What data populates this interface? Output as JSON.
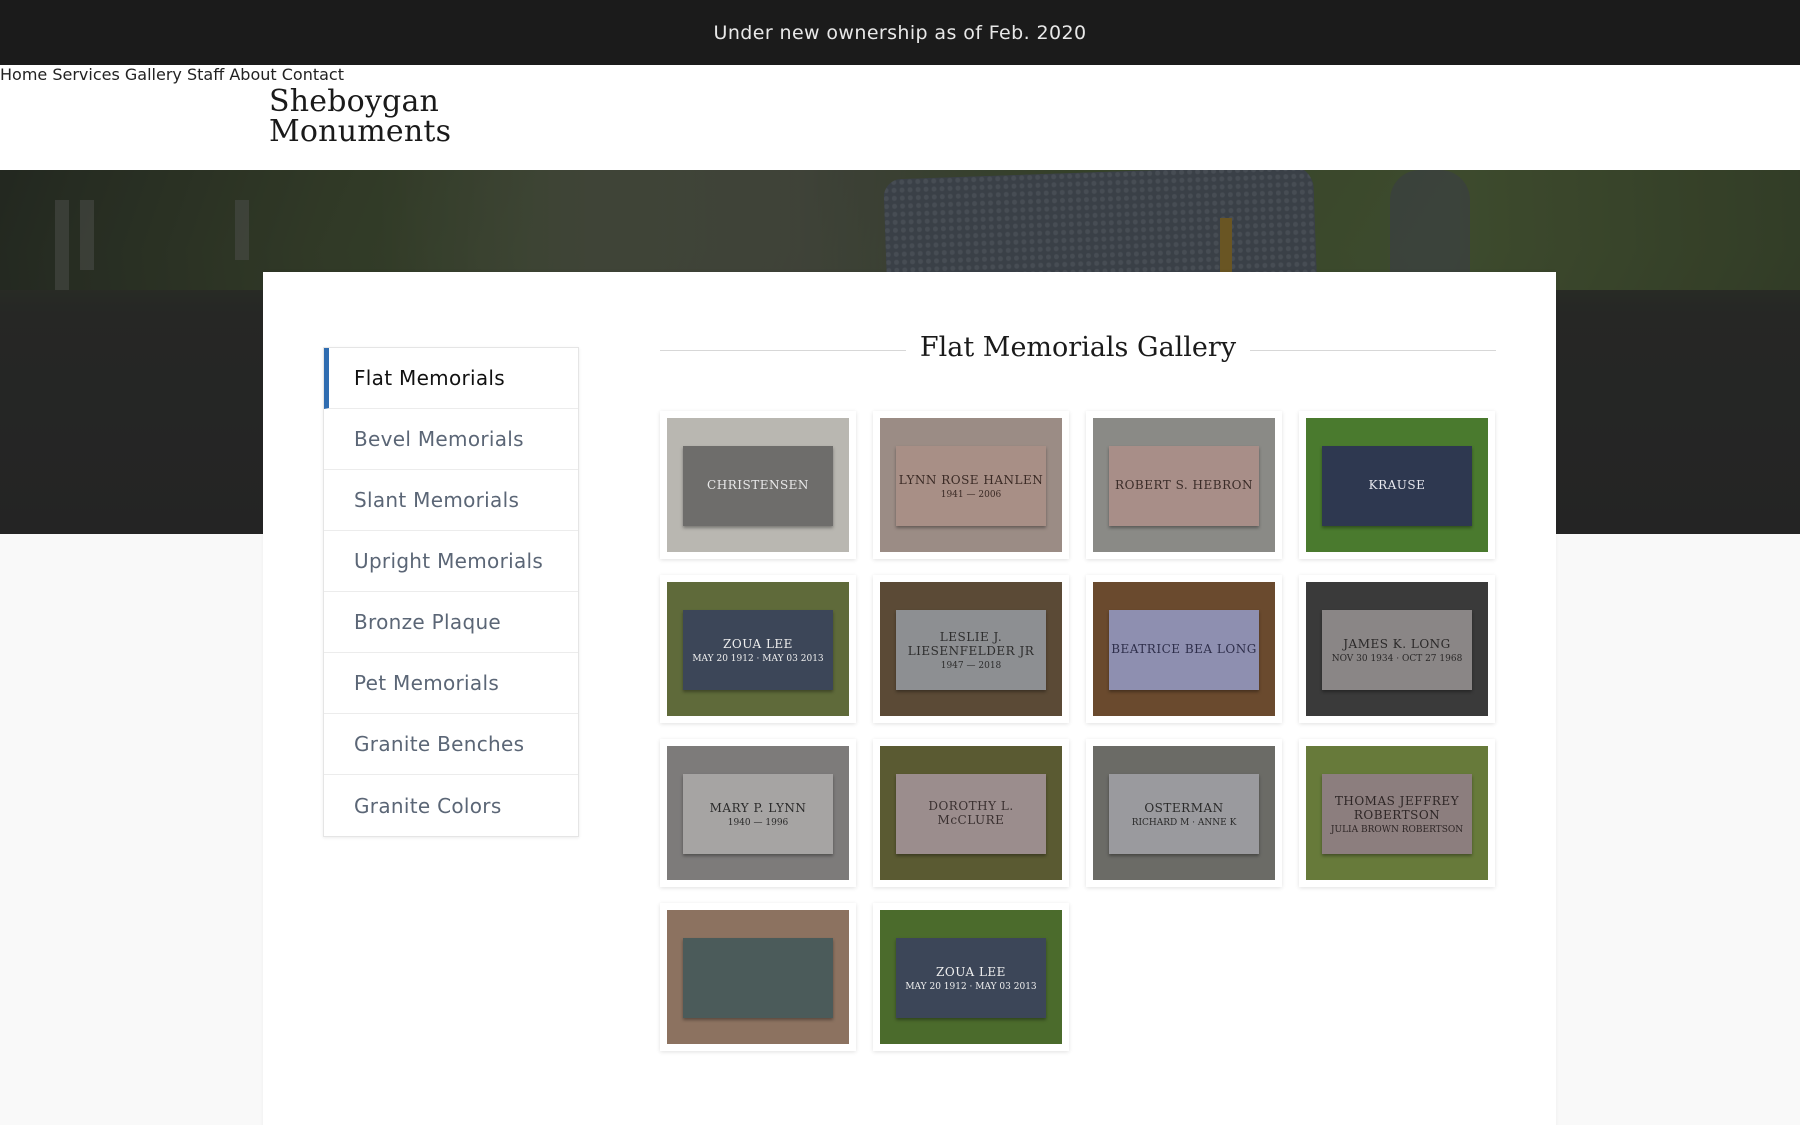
{
  "announcement": "Under new ownership as of Feb. 2020",
  "logo": {
    "line1": "Sheboygan",
    "line2": "Monuments"
  },
  "nav": [
    "Home",
    "Services",
    "Gallery",
    "Staff",
    "About",
    "Contact"
  ],
  "sidebar": {
    "items": [
      {
        "label": "Flat Memorials",
        "active": true
      },
      {
        "label": "Bevel Memorials"
      },
      {
        "label": "Slant Memorials"
      },
      {
        "label": "Upright Memorials"
      },
      {
        "label": "Bronze Plaque"
      },
      {
        "label": "Pet Memorials"
      },
      {
        "label": "Granite Benches"
      },
      {
        "label": "Granite Colors"
      }
    ]
  },
  "gallery": {
    "title": "Flat Memorials Gallery",
    "photos": [
      {
        "line1": "CHRISTENSEN",
        "line2": "",
        "stone": "#6e6d6b",
        "bg": "#b9b7b1",
        "text": "#e9e9e9"
      },
      {
        "line1": "LYNN ROSE HANLEN",
        "line2": "1941 — 2006",
        "stone": "#a88f86",
        "bg": "#9b8c85",
        "text": "#3a2a25"
      },
      {
        "line1": "ROBERT S. HEBRON",
        "line2": "",
        "stone": "#a88e88",
        "bg": "#8a8a86",
        "text": "#3a2c28"
      },
      {
        "line1": "KRAUSE",
        "line2": "",
        "stone": "#2e3850",
        "bg": "#4a7a2e",
        "text": "#e8e8ef"
      },
      {
        "line1": "ZOUA LEE",
        "line2": "MAY 20 1912 · MAY 03 2013",
        "stone": "#3c4658",
        "bg": "#5f6a3a",
        "text": "#eeeeee"
      },
      {
        "line1": "LESLIE J. LIESENFELDER JR",
        "line2": "1947 — 2018",
        "stone": "#8d8f92",
        "bg": "#5b4a36",
        "text": "#2d2d2d"
      },
      {
        "line1": "BEATRICE BEA LONG",
        "line2": "",
        "stone": "#8e8fb0",
        "bg": "#6a4a2e",
        "text": "#2e2e4a"
      },
      {
        "line1": "JAMES K. LONG",
        "line2": "NOV 30 1934 · OCT 27 1968",
        "stone": "#8a8686",
        "bg": "#3a3a3a",
        "text": "#2a2828"
      },
      {
        "line1": "MARY P. LYNN",
        "line2": "1940 — 1996",
        "stone": "#a6a4a3",
        "bg": "#7d7b7a",
        "text": "#2a2a2a"
      },
      {
        "line1": "DOROTHY L. McCLURE",
        "line2": "",
        "stone": "#9b8d8d",
        "bg": "#5a5a32",
        "text": "#3a3030"
      },
      {
        "line1": "OSTERMAN",
        "line2": "RICHARD M · ANNE K",
        "stone": "#9a9a9e",
        "bg": "#6b6b66",
        "text": "#2a2a2a"
      },
      {
        "line1": "THOMAS JEFFREY ROBERTSON",
        "line2": "JULIA BROWN ROBERTSON",
        "stone": "#8c7e7e",
        "bg": "#677a3a",
        "text": "#2e2626"
      },
      {
        "line1": "",
        "line2": "",
        "stone": "#4b5b5a",
        "bg": "#8c7260",
        "text": "#9aa0a0"
      },
      {
        "line1": "ZOUA LEE",
        "line2": "MAY 20 1912 · MAY 03 2013",
        "stone": "#3c4658",
        "bg": "#4b6b2c",
        "text": "#eeeeee"
      }
    ]
  }
}
